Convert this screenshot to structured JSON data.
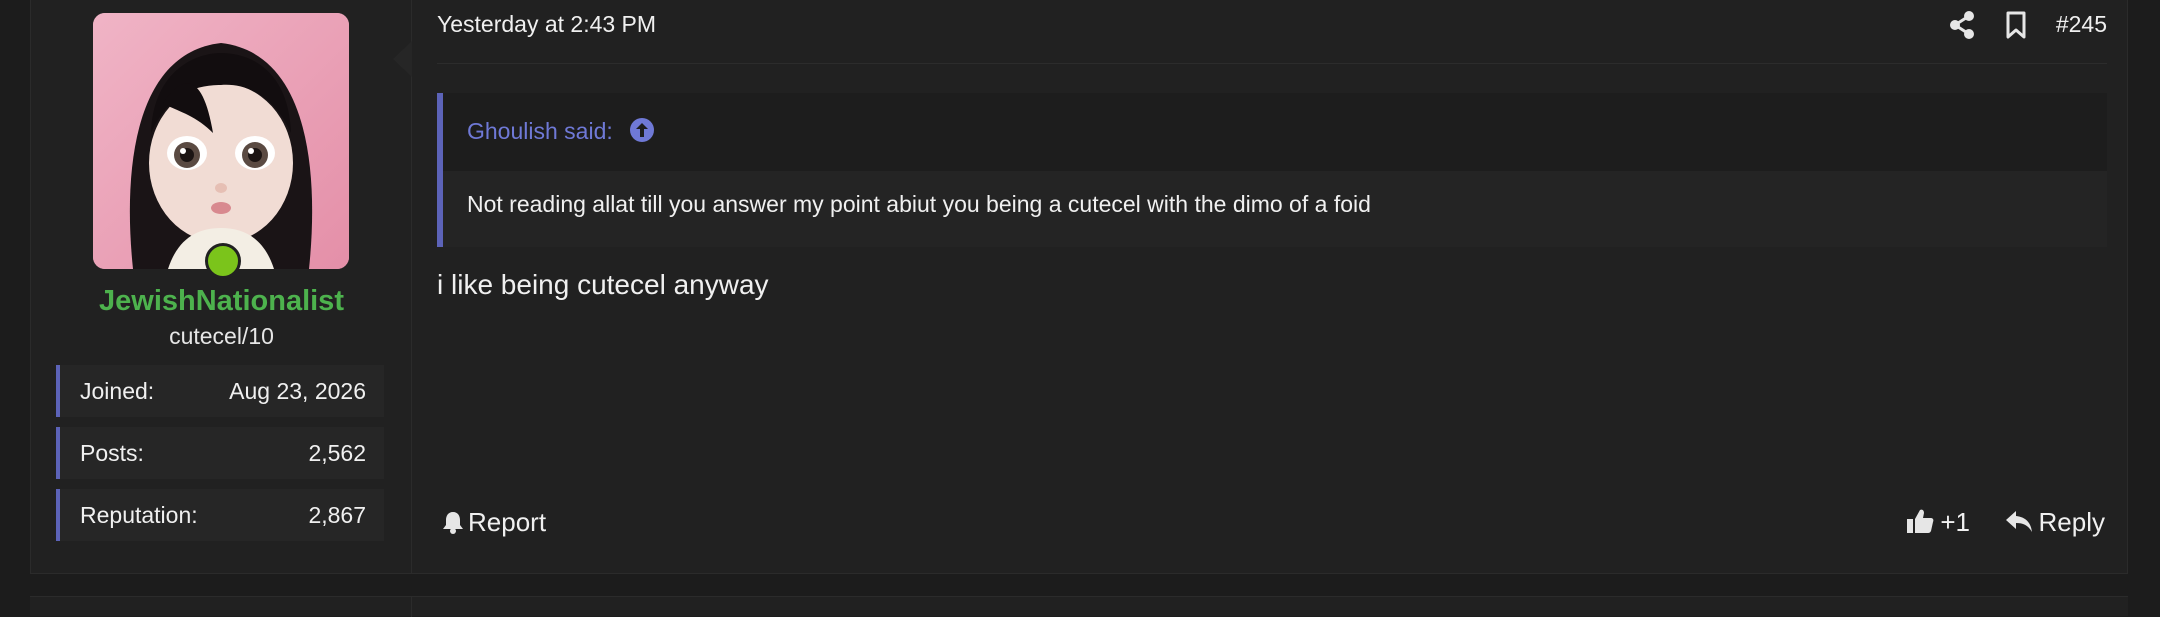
{
  "user": {
    "username": "JewishNationalist",
    "title": "cutecel/10",
    "online": true,
    "name_color": "#4db24d",
    "stats": [
      {
        "label": "Joined:",
        "value": "Aug 23, 2026"
      },
      {
        "label": "Posts:",
        "value": "2,562"
      },
      {
        "label": "Reputation:",
        "value": "2,867"
      }
    ]
  },
  "post": {
    "date": "Yesterday at 2:43 PM",
    "number": "#245",
    "icons": [
      "share-icon",
      "bookmark-icon"
    ],
    "quote": {
      "author_line": "Ghoulish said:",
      "text": "Not reading allat till you answer my point abiut you being a cutecel with the dimo of a foid"
    },
    "message": "i like being cutecel anyway"
  },
  "actions": {
    "report_label": "Report",
    "like_label": "+1",
    "reply_label": "Reply"
  },
  "colors": {
    "accent": "#5c63b8",
    "quote_link": "#6f79d6",
    "background": "#1c1c1c",
    "online": "#7bc41b"
  }
}
